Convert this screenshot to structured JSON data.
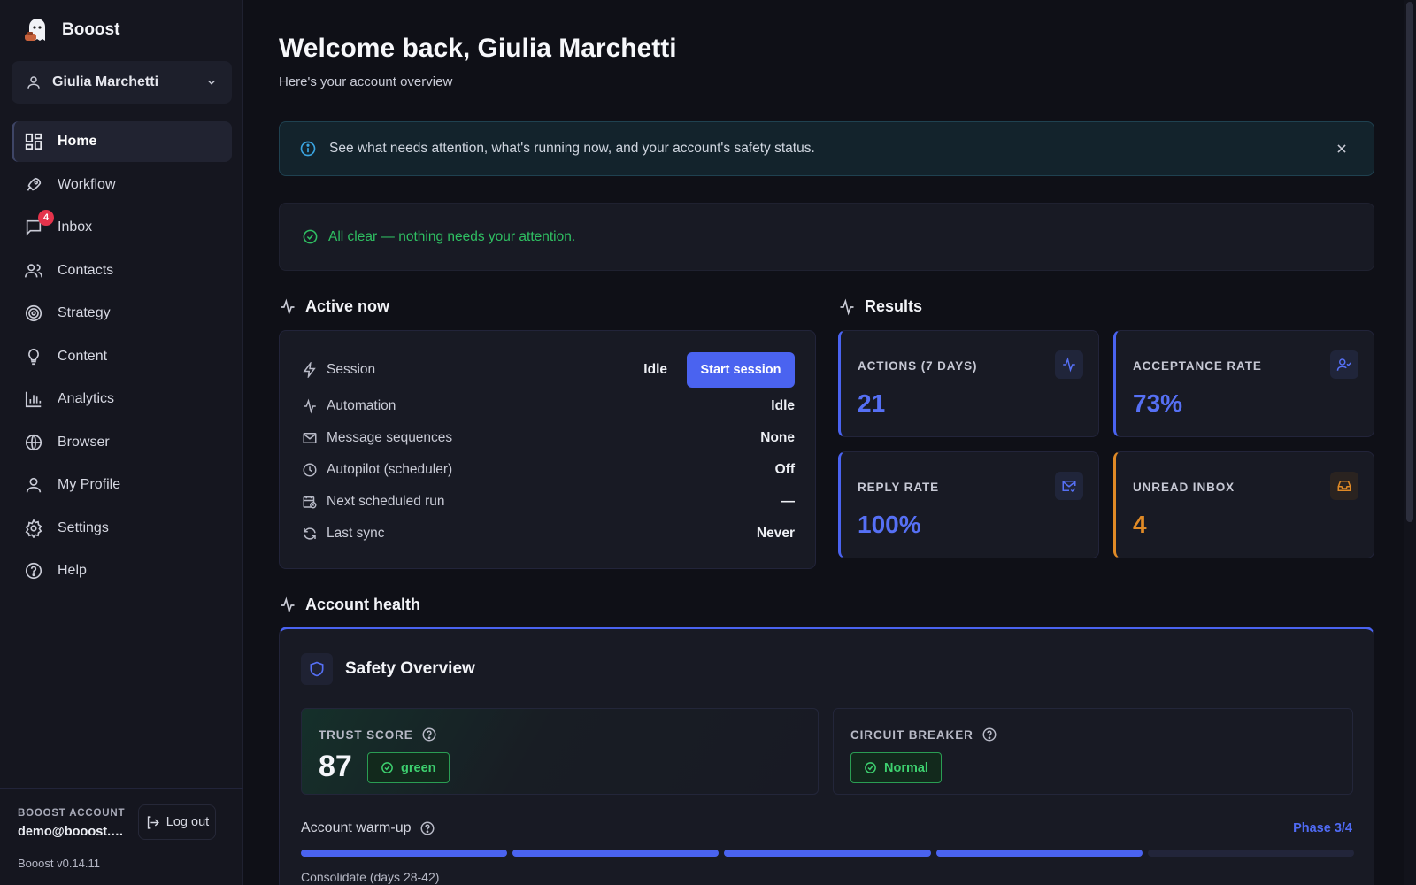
{
  "brand": {
    "name": "Booost"
  },
  "account": {
    "name": "Giulia Marchetti"
  },
  "nav": [
    {
      "key": "home",
      "label": "Home",
      "icon": "grid-icon",
      "active": true
    },
    {
      "key": "workflow",
      "label": "Workflow",
      "icon": "rocket-icon"
    },
    {
      "key": "inbox",
      "label": "Inbox",
      "icon": "message-icon",
      "badge": "4"
    },
    {
      "key": "contacts",
      "label": "Contacts",
      "icon": "users-icon"
    },
    {
      "key": "strategy",
      "label": "Strategy",
      "icon": "target-icon"
    },
    {
      "key": "content",
      "label": "Content",
      "icon": "lightbulb-icon"
    },
    {
      "key": "analytics",
      "label": "Analytics",
      "icon": "bar-chart-icon"
    },
    {
      "key": "browser",
      "label": "Browser",
      "icon": "globe-icon"
    },
    {
      "key": "my-profile",
      "label": "My Profile",
      "icon": "user-icon"
    },
    {
      "key": "settings",
      "label": "Settings",
      "icon": "gear-icon"
    },
    {
      "key": "help",
      "label": "Help",
      "icon": "help-circle-icon"
    }
  ],
  "footer": {
    "account_label": "BOOOST ACCOUNT",
    "email": "demo@booost.n...",
    "logout_label": "Log out",
    "version": "Booost v0.14.11"
  },
  "header": {
    "title": "Welcome back, Giulia Marchetti",
    "subtitle": "Here's your account overview"
  },
  "info_banner": {
    "text": "See what needs attention, what's running now, and your account's safety status."
  },
  "attention": {
    "text": "All clear — nothing needs your attention."
  },
  "active_now": {
    "title": "Active now",
    "start_button": "Start session",
    "rows": [
      {
        "label": "Session",
        "value": "Idle",
        "icon": "bolt-icon"
      },
      {
        "label": "Automation",
        "value": "Idle",
        "icon": "activity-icon"
      },
      {
        "label": "Message sequences",
        "value": "None",
        "icon": "mail-icon"
      },
      {
        "label": "Autopilot (scheduler)",
        "value": "Off",
        "icon": "clock-icon"
      },
      {
        "label": "Next scheduled run",
        "value": "—",
        "icon": "calendar-clock-icon"
      },
      {
        "label": "Last sync",
        "value": "Never",
        "icon": "refresh-icon"
      }
    ]
  },
  "results": {
    "title": "Results",
    "cards": [
      {
        "label": "ACTIONS (7 DAYS)",
        "value": "21",
        "icon": "activity-icon",
        "color": "#5670f5"
      },
      {
        "label": "ACCEPTANCE RATE",
        "value": "73%",
        "icon": "user-check-icon",
        "color": "#5670f5"
      },
      {
        "label": "REPLY RATE",
        "value": "100%",
        "icon": "mail-check-icon",
        "color": "#5670f5"
      },
      {
        "label": "UNREAD INBOX",
        "value": "4",
        "icon": "inbox-icon",
        "color": "#e08a26"
      }
    ]
  },
  "account_health": {
    "title": "Account health",
    "safety_title": "Safety Overview",
    "trust_label": "TRUST SCORE",
    "trust_score": "87",
    "trust_status": "green",
    "circuit_label": "CIRCUIT BREAKER",
    "circuit_status": "Normal",
    "warmup_label": "Account warm-up",
    "phase": "Phase 3/4",
    "warmup_progress": 0.8,
    "warmup_stage": "Consolidate (days 28-42)"
  },
  "colors": {
    "accent": "#4a63f0",
    "success": "#2fbf62",
    "warning": "#e08a26",
    "danger": "#e5334b"
  }
}
